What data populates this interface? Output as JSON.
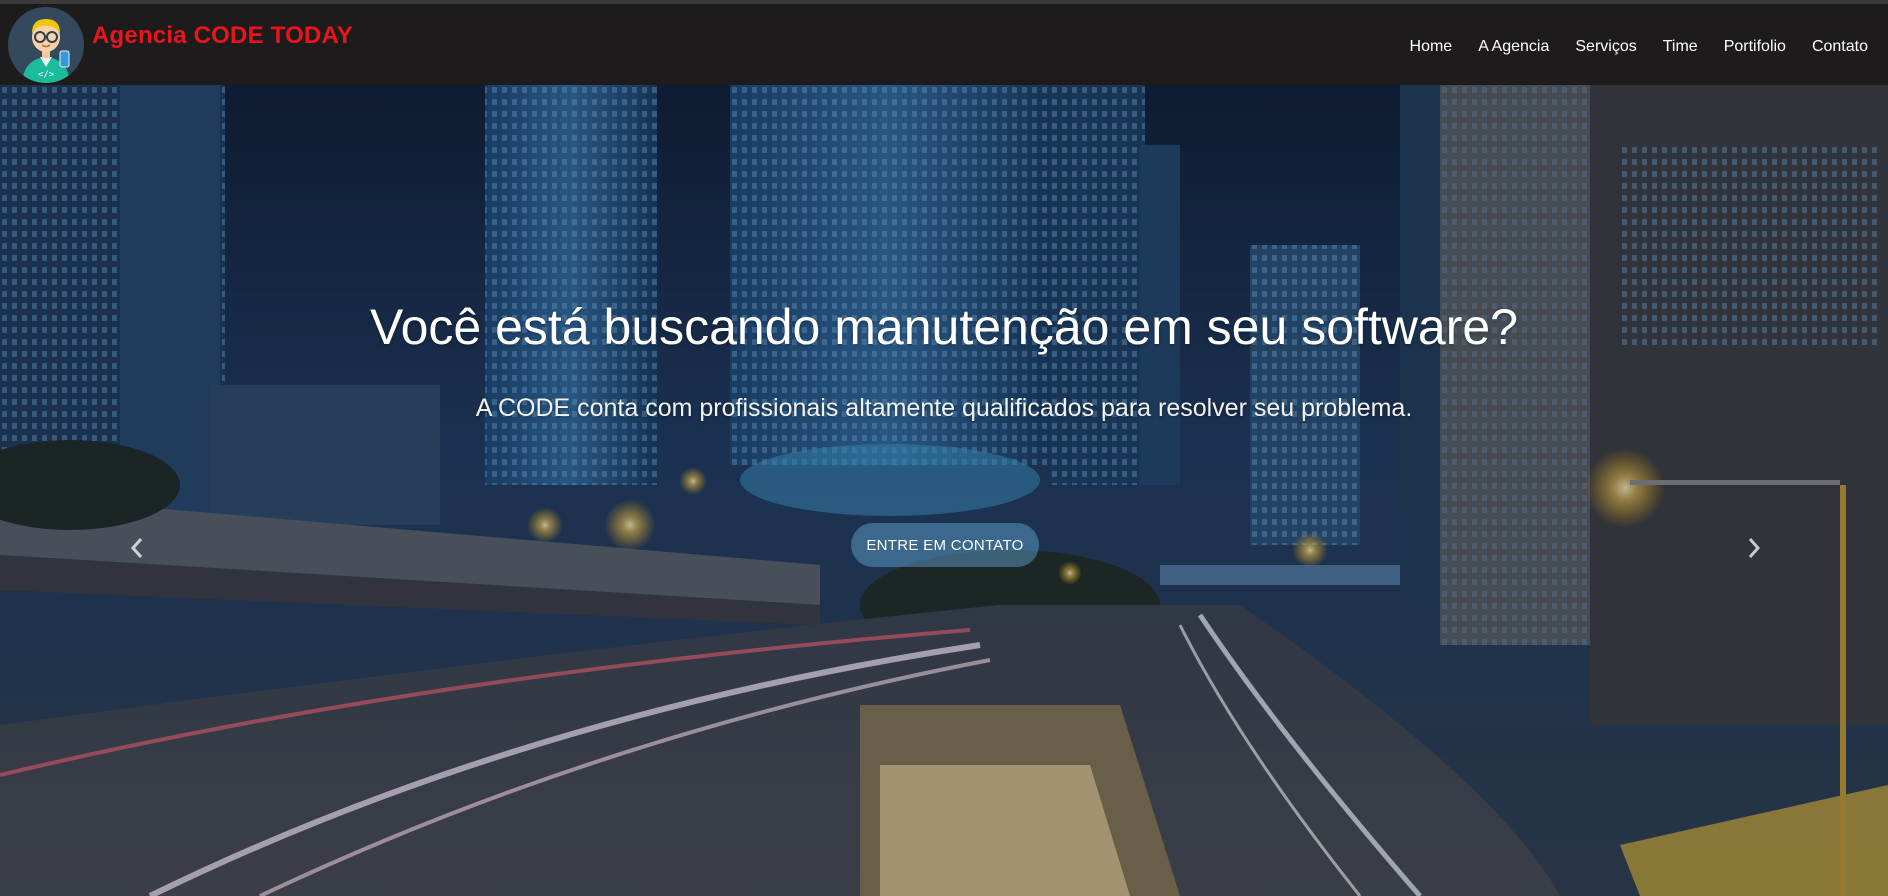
{
  "navbar": {
    "brand_name": "Agencia CODE TODAY",
    "logo_icon": "developer-avatar-icon",
    "menu": [
      {
        "label": "Home"
      },
      {
        "label": "A Agencia"
      },
      {
        "label": "Serviços"
      },
      {
        "label": "Time"
      },
      {
        "label": "Portifolio"
      },
      {
        "label": "Contato"
      }
    ]
  },
  "hero": {
    "title": "Você está buscando manutenção em seu software?",
    "subtitle": "A CODE conta com profissionais altamente qualificados para resolver seu problema.",
    "cta_label": "ENTRE EM CONTATO",
    "prev_icon": "chevron-left-icon",
    "next_icon": "chevron-right-icon"
  },
  "colors": {
    "navbar_bg": "#1d1b1c",
    "brand": "#e8161b",
    "nav_text": "#ffffff",
    "cta_bg": "rgba(100,170,220,0.45)"
  }
}
